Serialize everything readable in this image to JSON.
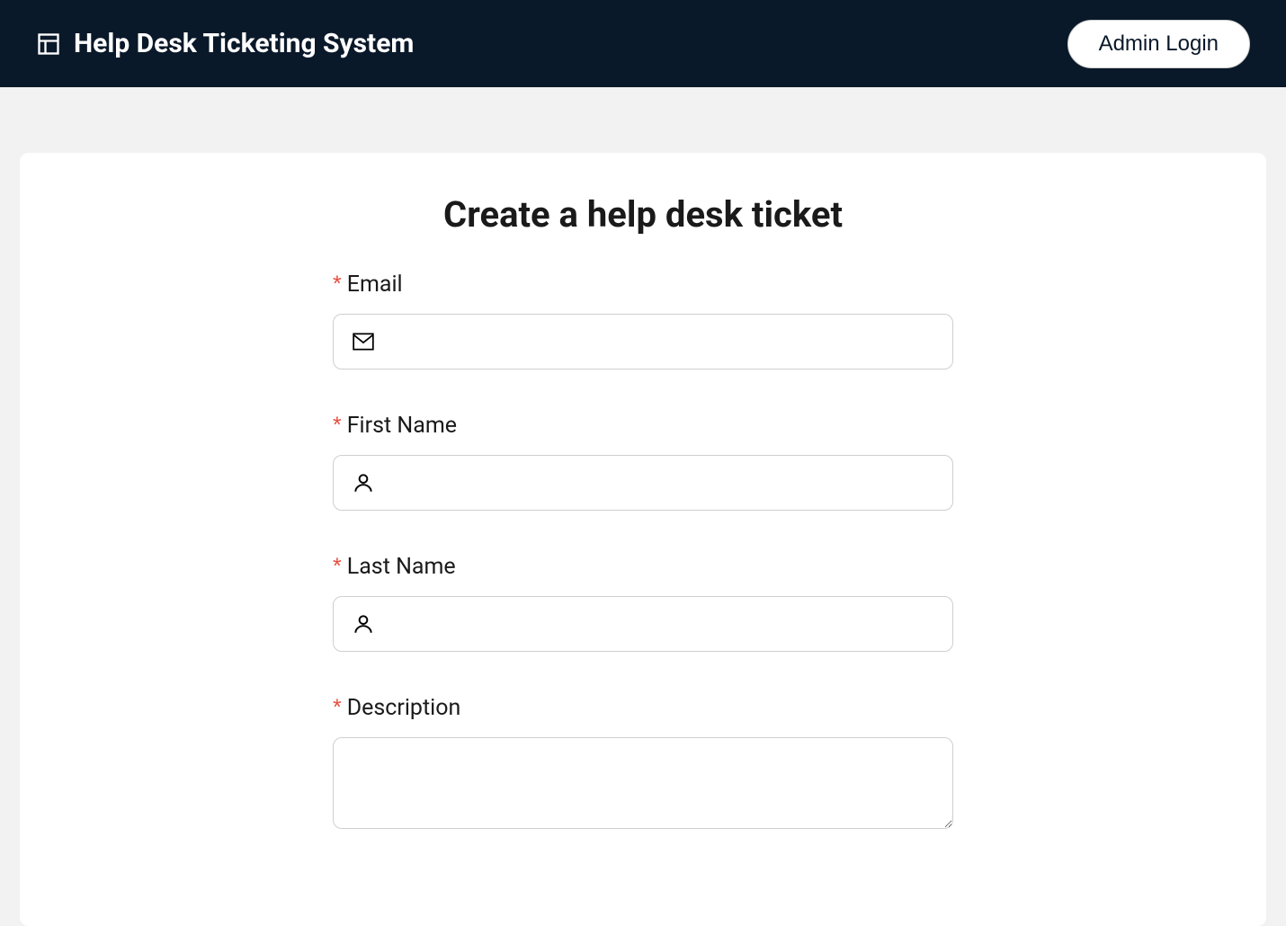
{
  "header": {
    "title": "Help Desk Ticketing System",
    "admin_login_label": "Admin Login"
  },
  "main": {
    "page_title": "Create a help desk ticket",
    "fields": {
      "email": {
        "label": "Email",
        "value": "",
        "required": true
      },
      "first_name": {
        "label": "First Name",
        "value": "",
        "required": true
      },
      "last_name": {
        "label": "Last Name",
        "value": "",
        "required": true
      },
      "description": {
        "label": "Description",
        "value": "",
        "required": true
      }
    }
  }
}
